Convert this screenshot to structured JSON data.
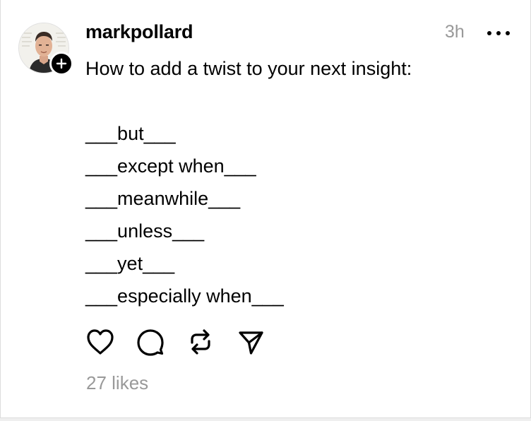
{
  "post": {
    "username": "markpollard",
    "timestamp": "3h",
    "body_lines": [
      "How to add a twist to your next insight:",
      "",
      "___but___",
      "___except when___",
      "___meanwhile___",
      "___unless___",
      "___yet___",
      "___especially when___"
    ],
    "likes": "27 likes"
  },
  "icons": {
    "follow": "plus-icon",
    "more": "more-horizontal-icon",
    "like": "heart-icon",
    "comment": "comment-icon",
    "repost": "repost-icon",
    "share": "send-icon"
  },
  "colors": {
    "text": "#000000",
    "muted": "#999999",
    "background": "#ffffff"
  }
}
